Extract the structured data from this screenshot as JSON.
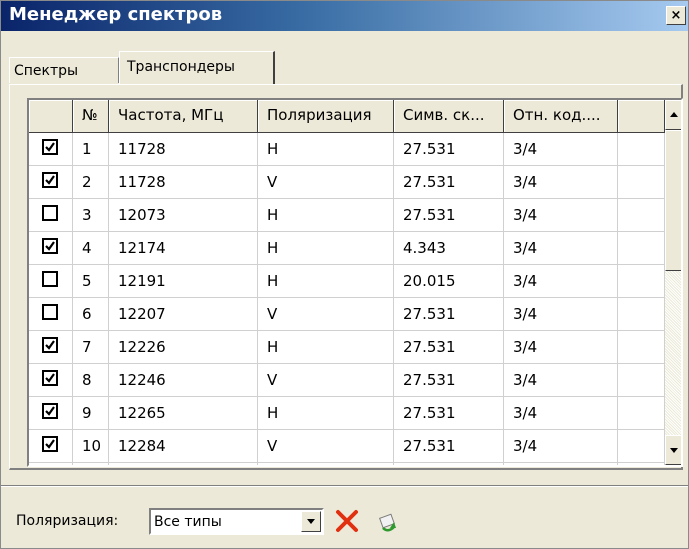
{
  "window": {
    "title": "Менеджер спектров",
    "close_label": "×"
  },
  "tabs": [
    {
      "label": "Спектры",
      "active": false
    },
    {
      "label": "Транспондеры",
      "active": true
    }
  ],
  "grid": {
    "columns": [
      "",
      "№",
      "Частота, МГц",
      "Поляризация",
      "Симв. ск...",
      "Отн. код...."
    ],
    "rows": [
      {
        "checked": true,
        "num": "1",
        "freq": "11728",
        "pol": "H",
        "sym": "27.531",
        "fec": "3/4"
      },
      {
        "checked": true,
        "num": "2",
        "freq": "11728",
        "pol": "V",
        "sym": "27.531",
        "fec": "3/4"
      },
      {
        "checked": false,
        "num": "3",
        "freq": "12073",
        "pol": "H",
        "sym": "27.531",
        "fec": "3/4"
      },
      {
        "checked": true,
        "num": "4",
        "freq": "12174",
        "pol": "H",
        "sym": "4.343",
        "fec": "3/4"
      },
      {
        "checked": false,
        "num": "5",
        "freq": "12191",
        "pol": "H",
        "sym": "20.015",
        "fec": "3/4"
      },
      {
        "checked": false,
        "num": "6",
        "freq": "12207",
        "pol": "V",
        "sym": "27.531",
        "fec": "3/4"
      },
      {
        "checked": true,
        "num": "7",
        "freq": "12226",
        "pol": "H",
        "sym": "27.531",
        "fec": "3/4"
      },
      {
        "checked": true,
        "num": "8",
        "freq": "12246",
        "pol": "V",
        "sym": "27.531",
        "fec": "3/4"
      },
      {
        "checked": true,
        "num": "9",
        "freq": "12265",
        "pol": "H",
        "sym": "27.531",
        "fec": "3/4"
      },
      {
        "checked": true,
        "num": "10",
        "freq": "12284",
        "pol": "V",
        "sym": "27.531",
        "fec": "3/4"
      }
    ]
  },
  "filter": {
    "label": "Поляризация:",
    "value": "Все типы"
  },
  "icons": {
    "delete": "red-x-icon",
    "refresh": "refresh-icon"
  },
  "colors": {
    "titlebar_start": "#0a246a",
    "titlebar_end": "#a6caf0",
    "face": "#ece9d8",
    "delete_red": "#e03010"
  }
}
